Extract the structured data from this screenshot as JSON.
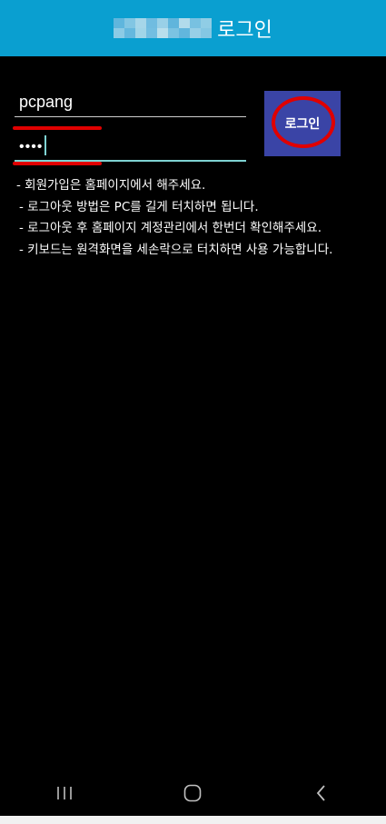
{
  "theme": {
    "accent": "#0a9fd0",
    "button_bg": "#3a44a6",
    "highlight_red": "#e00000"
  },
  "appbar": {
    "title": "로그인"
  },
  "form": {
    "username_value": "pcpang",
    "password_masked": "••••",
    "login_button_label": "로그인"
  },
  "notes": [
    "- 회원가입은 홈페이지에서 해주세요.",
    "- 로그아웃 방법은 PC를 길게 터치하면 됩니다.",
    "- 로그아웃 후 홈페이지 계정관리에서 한번더 확인해주세요.",
    "- 키보드는 원격화면을 세손락으로 터치하면 사용 가능합니다."
  ],
  "navbar": {
    "icons": [
      "recent-apps-icon",
      "home-icon",
      "back-icon"
    ]
  }
}
